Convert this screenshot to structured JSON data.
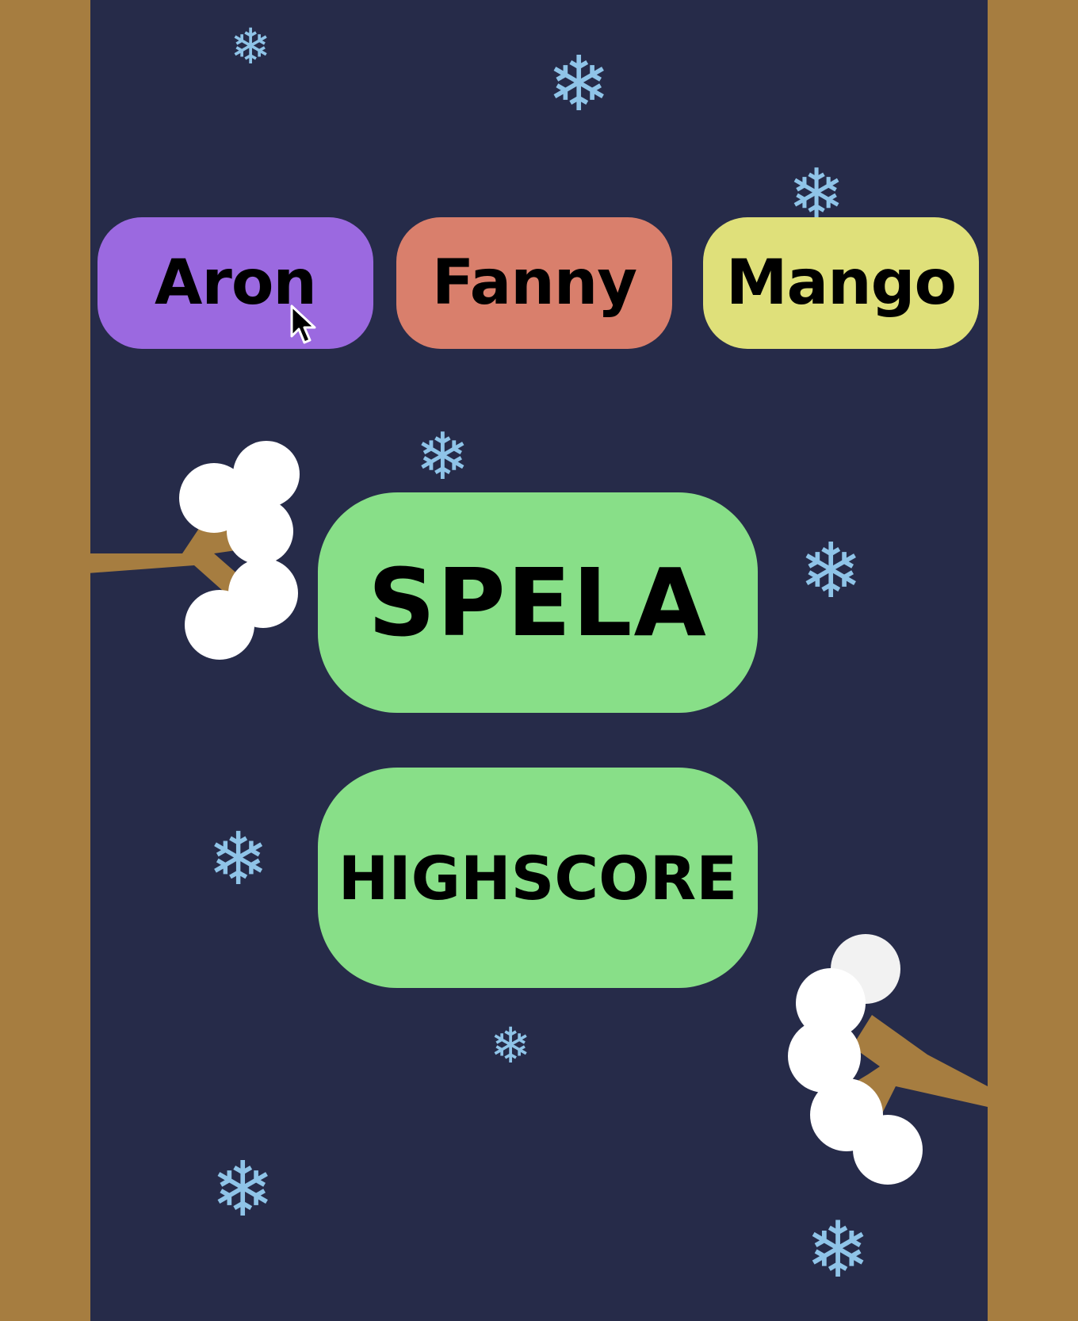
{
  "characters": [
    {
      "label": "Aron",
      "color": "#9b69e0"
    },
    {
      "label": "Fanny",
      "color": "#d97f6c"
    },
    {
      "label": "Mango",
      "color": "#dfe07a"
    }
  ],
  "menu": {
    "play_label": "SPELA",
    "highscore_label": "HIGHSCORE",
    "button_color": "#88df88"
  },
  "colors": {
    "background": "#262b49",
    "trunk": "#a67d40",
    "snow": "#ffffff",
    "snowflake": "#8fc4e8"
  },
  "icons": {
    "snowflake": "snowflake-icon",
    "cursor": "mouse-pointer-icon"
  }
}
